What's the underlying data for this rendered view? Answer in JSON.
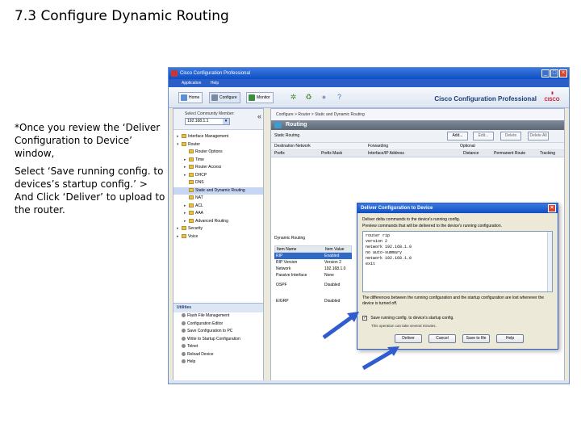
{
  "slide": {
    "title": "7.3 Configure Dynamic Routing",
    "instr_1": "*Once you review the ‘Deliver Configuration to Device’ window,",
    "instr_2": "Select ‘Save running config. to devices’s startup config.’ > And Click ‘Deliver’ to upload to the router."
  },
  "app": {
    "title": "Cisco Configuration Professional",
    "menu": [
      "Application",
      "Help"
    ],
    "toolbar": {
      "home": "Home",
      "configure": "Configure",
      "monitor": "Monitor"
    },
    "brand": "Cisco Configuration Professional",
    "logo_text": "CISCO",
    "device_label": "Select Community Member:",
    "device_value": "192.168.1.1",
    "tree": [
      {
        "label": "Interface Management",
        "level": 0,
        "toggle": "▸"
      },
      {
        "label": "Router",
        "level": 0,
        "toggle": "▾"
      },
      {
        "label": "Router Options",
        "level": 1,
        "toggle": ""
      },
      {
        "label": "Time",
        "level": 1,
        "toggle": "▸"
      },
      {
        "label": "Router Access",
        "level": 1,
        "toggle": "▸"
      },
      {
        "label": "DHCP",
        "level": 1,
        "toggle": "▸"
      },
      {
        "label": "DNS",
        "level": 1,
        "toggle": ""
      },
      {
        "label": "Static and Dynamic Routing",
        "level": 1,
        "toggle": "",
        "selected": true
      },
      {
        "label": "NAT",
        "level": 1,
        "toggle": ""
      },
      {
        "label": "ACL",
        "level": 1,
        "toggle": "▸"
      },
      {
        "label": "AAA",
        "level": 1,
        "toggle": "▸"
      },
      {
        "label": "Advanced Routing",
        "level": 1,
        "toggle": "▸"
      },
      {
        "label": "Security",
        "level": 0,
        "toggle": "▸"
      },
      {
        "label": "Voice",
        "level": 0,
        "toggle": "▸"
      }
    ],
    "utilities": {
      "header": "Utilities",
      "items": [
        "Flash File Management",
        "Configuration Editor",
        "Save Configuration to PC",
        "Write to Startup Configuration",
        "Telnet",
        "Reload Device",
        "Help"
      ]
    },
    "breadcrumb": "Configure > Router > Static and Dynamic Routing",
    "section": "Routing",
    "static_routing_label": "Static Routing",
    "route_buttons": [
      "Add...",
      "Edit...",
      "Delete",
      "Delete All"
    ],
    "route_head1": [
      "Destination Network",
      "Forwarding",
      "Optional"
    ],
    "route_head2": [
      "Prefix",
      "Prefix Mask",
      "Interface/IP Address",
      "Distance",
      "Permanent Route",
      "Tracking"
    ],
    "dynamic_label": "Dynamic Routing",
    "dyn_header": [
      "Item Name",
      "Item Value"
    ],
    "dyn_rows": [
      {
        "name": "RIP",
        "value": "Enabled",
        "selected": true
      },
      {
        "name": "RIP Version",
        "value": "Version 2"
      },
      {
        "name": "Network",
        "value": "192.168.1.0"
      },
      {
        "name": "Passive Interface",
        "value": "None"
      }
    ],
    "protocols": [
      {
        "name": "OSPF",
        "value": "Disabled"
      },
      {
        "name": "EIGRP",
        "value": "Disabled"
      }
    ]
  },
  "dialog": {
    "title": "Deliver Configuration to Device",
    "line1": "Deliver delta commands to the device's running config.",
    "line2": "Preview commands that will be delivered to the device's running configuration.",
    "commands": [
      "router rip",
      "version 2",
      "network 192.168.1.0",
      "no auto-summary",
      "network 192.168.1.0",
      "exit"
    ],
    "note": "The differences between the running configuration and the startup configuration are lost whenever the device is turned off.",
    "checkbox": "Save running config. to device's startup config.",
    "sub": "This operation can take several minutes.",
    "buttons": [
      "Deliver",
      "Cancel",
      "Save to file",
      "Help"
    ]
  },
  "colors": {
    "arrow": "#2f5ccf",
    "titlebar": "#1a5bd2",
    "selected": "#316ac5"
  }
}
